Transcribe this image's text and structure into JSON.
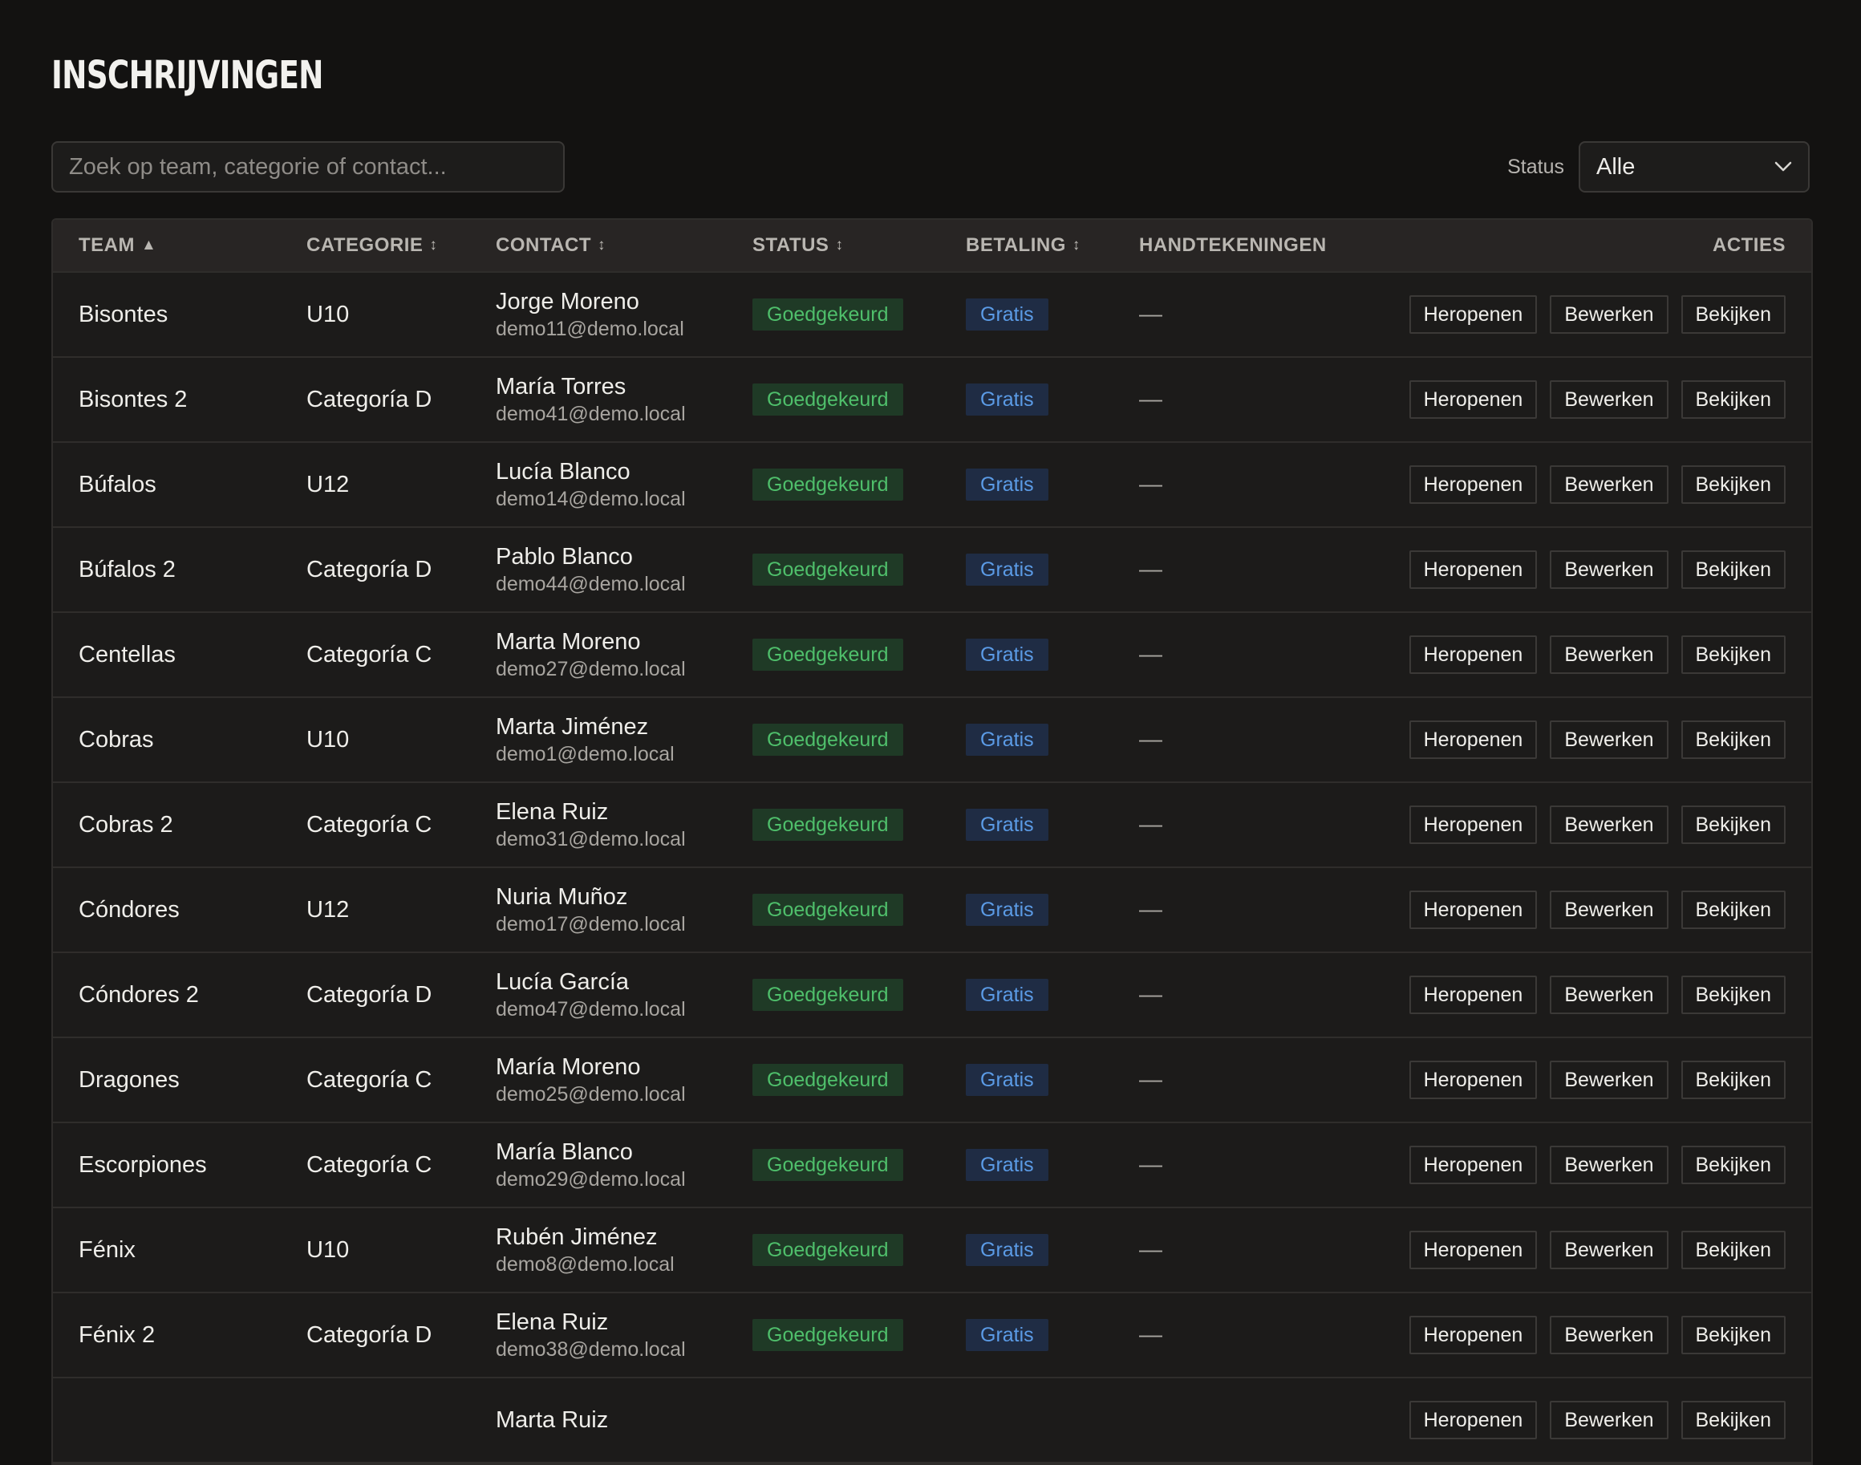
{
  "page": {
    "title": "Inschrijvingen"
  },
  "search": {
    "placeholder": "Zoek op team, categorie of contact...",
    "value": ""
  },
  "status_filter": {
    "label": "Status",
    "selected": "Alle",
    "icon": "chevron-down-icon"
  },
  "table": {
    "columns": {
      "team": "Team",
      "team_sort": "▲",
      "categorie": "Categorie",
      "categorie_sort": "↕",
      "contact": "Contact",
      "contact_sort": "↕",
      "status": "Status",
      "status_sort": "↕",
      "betaling": "Betaling",
      "betaling_sort": "↕",
      "handtekeningen": "Handtekeningen",
      "acties": "Acties"
    },
    "action_labels": {
      "reopen": "Heropenen",
      "edit": "Bewerken",
      "view": "Bekijken"
    },
    "rows": [
      {
        "team": "Bisontes",
        "categorie": "U10",
        "contact_name": "Jorge Moreno",
        "contact_email": "demo11@demo.local",
        "status": "Goedgekeurd",
        "betaling": "Gratis",
        "handtekeningen": "—"
      },
      {
        "team": "Bisontes 2",
        "categorie": "Categoría D",
        "contact_name": "María Torres",
        "contact_email": "demo41@demo.local",
        "status": "Goedgekeurd",
        "betaling": "Gratis",
        "handtekeningen": "—"
      },
      {
        "team": "Búfalos",
        "categorie": "U12",
        "contact_name": "Lucía Blanco",
        "contact_email": "demo14@demo.local",
        "status": "Goedgekeurd",
        "betaling": "Gratis",
        "handtekeningen": "—"
      },
      {
        "team": "Búfalos 2",
        "categorie": "Categoría D",
        "contact_name": "Pablo Blanco",
        "contact_email": "demo44@demo.local",
        "status": "Goedgekeurd",
        "betaling": "Gratis",
        "handtekeningen": "—"
      },
      {
        "team": "Centellas",
        "categorie": "Categoría C",
        "contact_name": "Marta Moreno",
        "contact_email": "demo27@demo.local",
        "status": "Goedgekeurd",
        "betaling": "Gratis",
        "handtekeningen": "—"
      },
      {
        "team": "Cobras",
        "categorie": "U10",
        "contact_name": "Marta Jiménez",
        "contact_email": "demo1@demo.local",
        "status": "Goedgekeurd",
        "betaling": "Gratis",
        "handtekeningen": "—"
      },
      {
        "team": "Cobras 2",
        "categorie": "Categoría C",
        "contact_name": "Elena Ruiz",
        "contact_email": "demo31@demo.local",
        "status": "Goedgekeurd",
        "betaling": "Gratis",
        "handtekeningen": "—"
      },
      {
        "team": "Cóndores",
        "categorie": "U12",
        "contact_name": "Nuria Muñoz",
        "contact_email": "demo17@demo.local",
        "status": "Goedgekeurd",
        "betaling": "Gratis",
        "handtekeningen": "—"
      },
      {
        "team": "Cóndores 2",
        "categorie": "Categoría D",
        "contact_name": "Lucía García",
        "contact_email": "demo47@demo.local",
        "status": "Goedgekeurd",
        "betaling": "Gratis",
        "handtekeningen": "—"
      },
      {
        "team": "Dragones",
        "categorie": "Categoría C",
        "contact_name": "María Moreno",
        "contact_email": "demo25@demo.local",
        "status": "Goedgekeurd",
        "betaling": "Gratis",
        "handtekeningen": "—"
      },
      {
        "team": "Escorpiones",
        "categorie": "Categoría C",
        "contact_name": "María Blanco",
        "contact_email": "demo29@demo.local",
        "status": "Goedgekeurd",
        "betaling": "Gratis",
        "handtekeningen": "—"
      },
      {
        "team": "Fénix",
        "categorie": "U10",
        "contact_name": "Rubén Jiménez",
        "contact_email": "demo8@demo.local",
        "status": "Goedgekeurd",
        "betaling": "Gratis",
        "handtekeningen": "—"
      },
      {
        "team": "Fénix 2",
        "categorie": "Categoría D",
        "contact_name": "Elena Ruiz",
        "contact_email": "demo38@demo.local",
        "status": "Goedgekeurd",
        "betaling": "Gratis",
        "handtekeningen": "—"
      },
      {
        "team": "",
        "categorie": "",
        "contact_name": "Marta Ruiz",
        "contact_email": "",
        "status": "",
        "betaling": "",
        "handtekeningen": ""
      }
    ]
  },
  "colors": {
    "background": "#131211",
    "status_badge_bg": "#1f3a26",
    "status_badge_text": "#4fbf6b",
    "pay_badge_bg": "#1f2c44",
    "pay_badge_text": "#5b9be6"
  }
}
